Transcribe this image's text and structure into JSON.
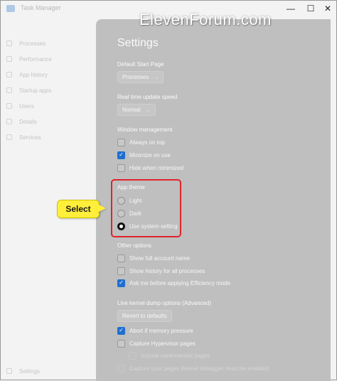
{
  "window": {
    "title": "Task Manager",
    "controls": {
      "minimize": "—",
      "maximize": "☐",
      "close": "✕"
    }
  },
  "watermark": "ElevenForum.com",
  "sidebar": {
    "items": [
      {
        "label": "Processes",
        "icon": "processes-icon"
      },
      {
        "label": "Performance",
        "icon": "performance-icon"
      },
      {
        "label": "App history",
        "icon": "app-history-icon"
      },
      {
        "label": "Startup apps",
        "icon": "startup-apps-icon"
      },
      {
        "label": "Users",
        "icon": "users-icon"
      },
      {
        "label": "Details",
        "icon": "details-icon"
      },
      {
        "label": "Services",
        "icon": "services-icon"
      }
    ],
    "settings_label": "Settings"
  },
  "settings": {
    "title": "Settings",
    "default_start_page": {
      "label": "Default Start Page",
      "value": "Processes"
    },
    "realtime_update": {
      "label": "Real time update speed",
      "value": "Normal"
    },
    "window_management": {
      "label": "Window management",
      "options": [
        {
          "label": "Always on top",
          "checked": false
        },
        {
          "label": "Minimize on use",
          "checked": true
        },
        {
          "label": "Hide when minimized",
          "checked": false
        }
      ]
    },
    "app_theme": {
      "label": "App theme",
      "options": [
        {
          "label": "Light",
          "selected": false
        },
        {
          "label": "Dark",
          "selected": false
        },
        {
          "label": "Use system setting",
          "selected": true
        }
      ]
    },
    "other_options": {
      "label": "Other options",
      "options": [
        {
          "label": "Show full account name",
          "checked": false
        },
        {
          "label": "Show history for all processes",
          "checked": false
        },
        {
          "label": "Ask me before applying Efficiency mode",
          "checked": true
        }
      ]
    },
    "kernel_dump": {
      "label": "Live kernel dump options (Advanced)",
      "revert_label": "Revert to defaults",
      "options": [
        {
          "label": "Abort if memory pressure",
          "checked": true
        },
        {
          "label": "Capture Hypervisor pages",
          "checked": false
        },
        {
          "label": "Include nonessential pages",
          "checked": false
        },
        {
          "label": "Capture user pages (kernel debugger must be enabled)",
          "checked": false
        }
      ]
    }
  },
  "callout": {
    "label": "Select"
  },
  "colors": {
    "accent": "#1f6fd0",
    "highlight": "#e0232b",
    "callout": "#ffef3a"
  }
}
